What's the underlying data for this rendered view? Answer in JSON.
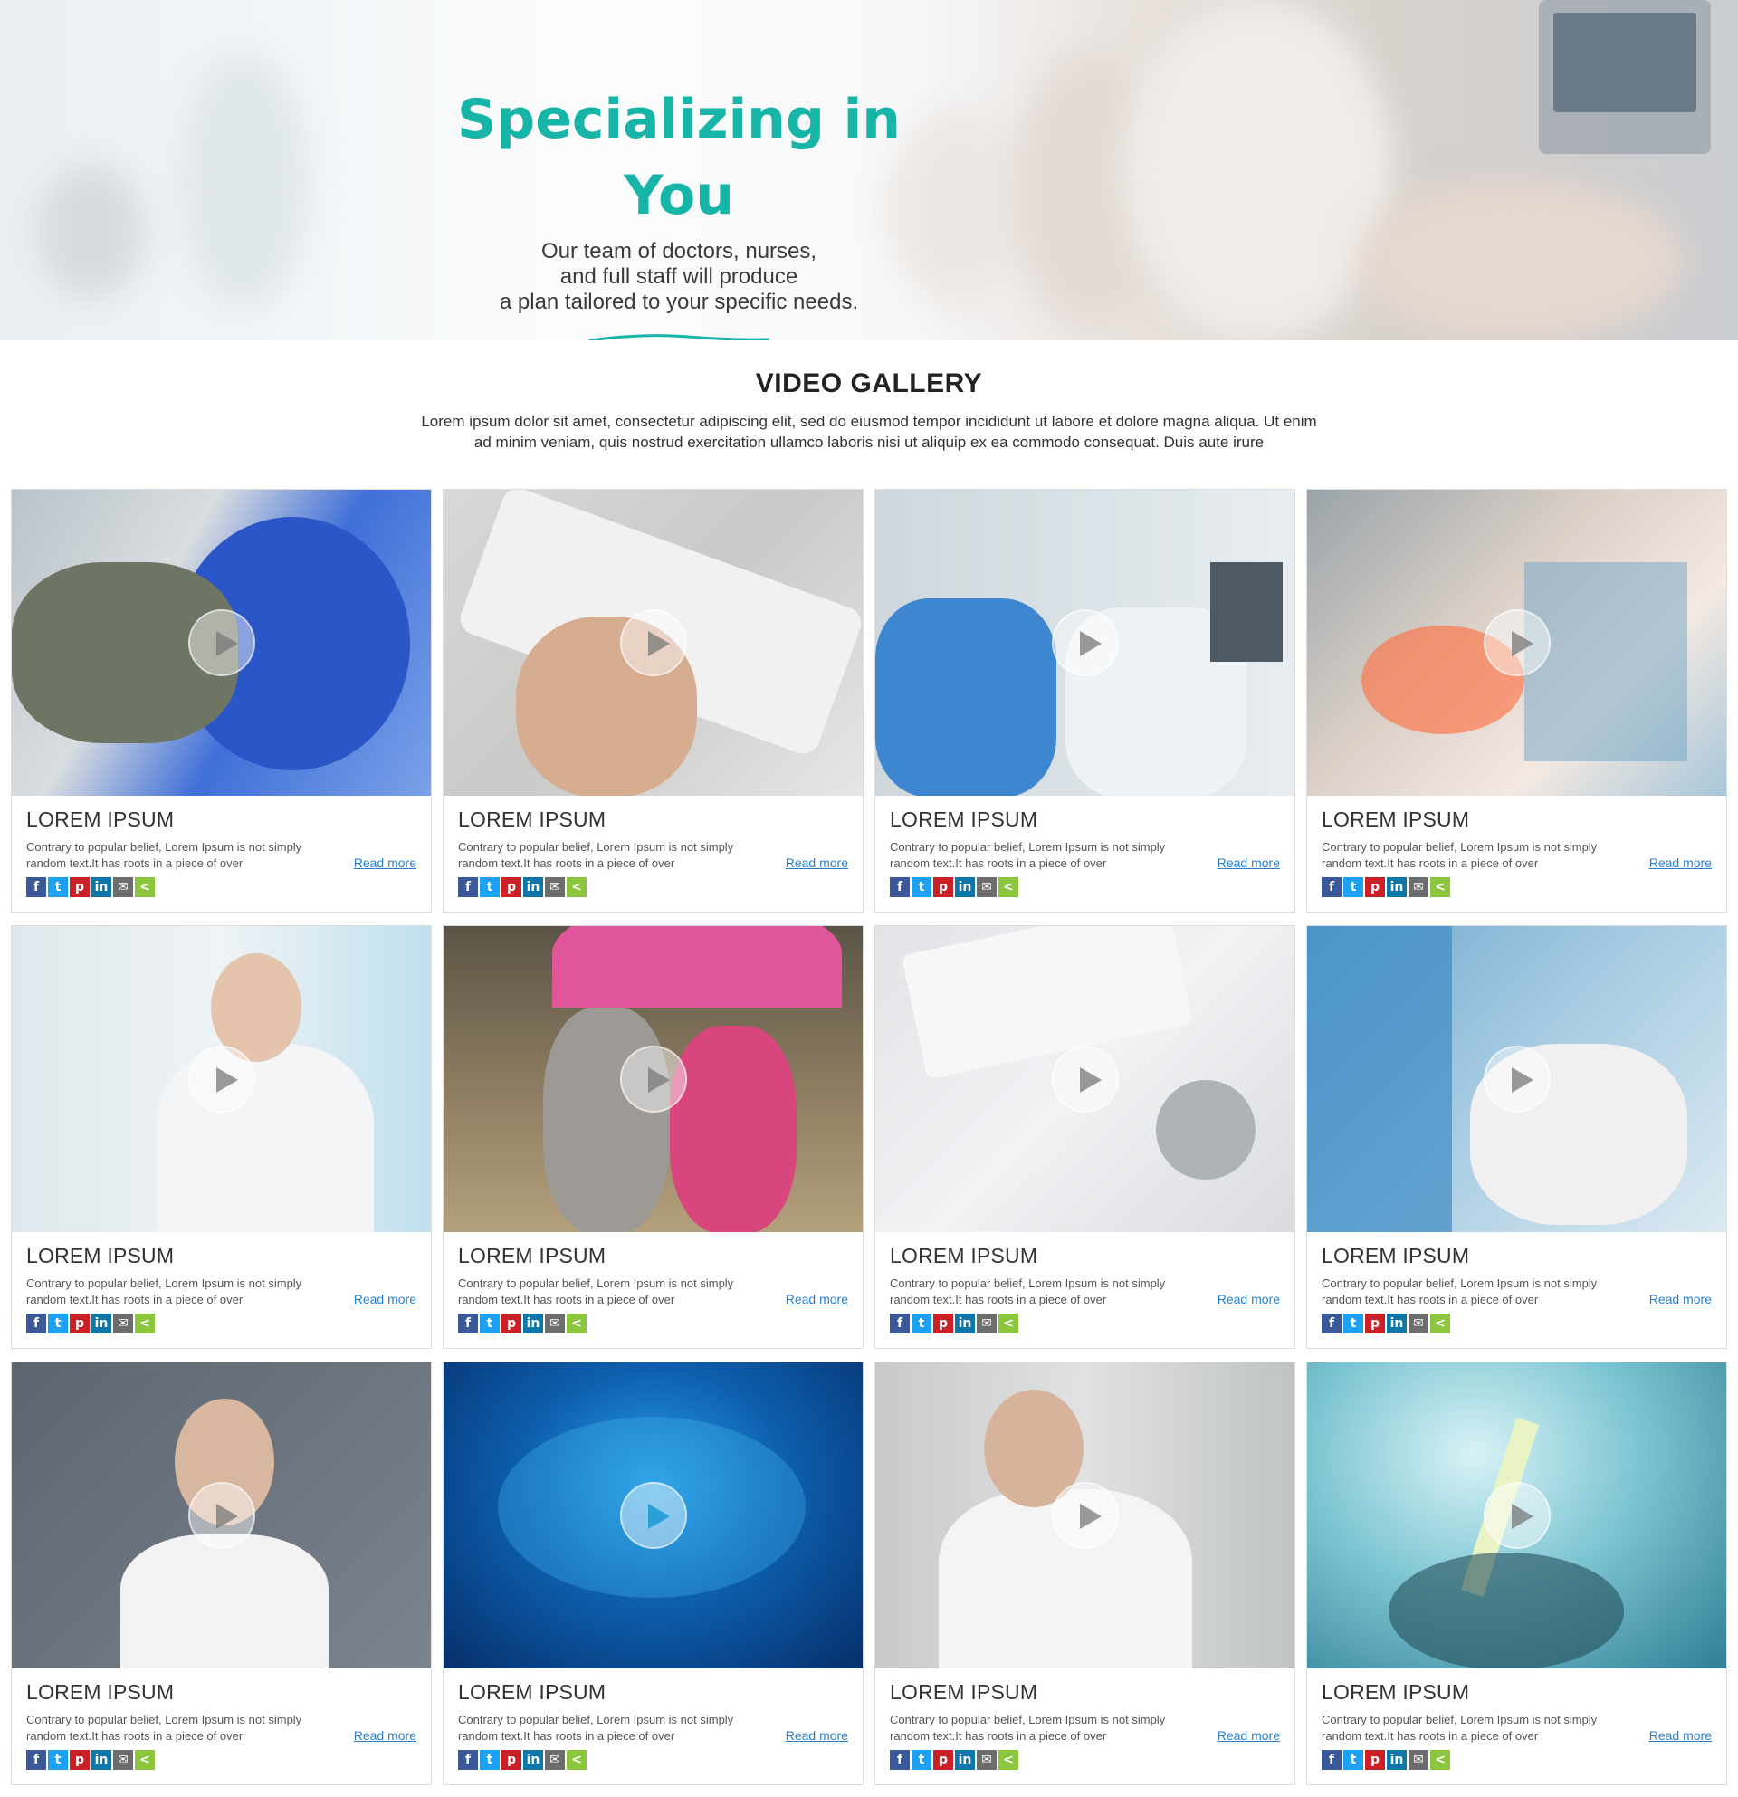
{
  "hero": {
    "title": "Specializing in You",
    "subtitle_lines": [
      "Our team of doctors, nurses,",
      "and full staff will produce",
      "a plan tailored to your specific needs."
    ],
    "accent_color": "#16b5a7"
  },
  "gallery": {
    "title": "VIDEO GALLERY",
    "description_lines": [
      "Lorem ipsum dolor sit amet, consectetur adipiscing elit, sed do eiusmod tempor incididunt ut labore et dolore magna aliqua. Ut enim",
      "ad minim veniam, quis nostrud exercitation ullamco laboris nisi ut aliquip ex ea commodo consequat. Duis aute irure"
    ]
  },
  "share_buttons": [
    {
      "icon": "facebook-icon",
      "glyph": "f",
      "color": "#3b5998"
    },
    {
      "icon": "twitter-icon",
      "glyph": "t",
      "color": "#1da1f2"
    },
    {
      "icon": "pinterest-icon",
      "glyph": "p",
      "color": "#cb2027"
    },
    {
      "icon": "linkedin-icon",
      "glyph": "in",
      "color": "#0e76a8"
    },
    {
      "icon": "email-icon",
      "glyph": "✉",
      "color": "#6d6d6d"
    },
    {
      "icon": "share-icon",
      "glyph": "<",
      "color": "#8cc63f"
    }
  ],
  "cards": [
    {
      "title": "LOREM IPSUM",
      "text_lines": [
        "Contrary to popular belief, Lorem Ipsum is not simply",
        "random text.It has roots in a piece of over"
      ],
      "read_more": "Read more",
      "image": "mri-scanner-patient",
      "play_style": "grey"
    },
    {
      "title": "LOREM IPSUM",
      "text_lines": [
        "Contrary to popular belief, Lorem Ipsum is not simply",
        "random text.It has roots in a piece of over"
      ],
      "read_more": "Read more",
      "image": "hand-holding-tablet",
      "play_style": "grey"
    },
    {
      "title": "LOREM IPSUM",
      "text_lines": [
        "Contrary to popular belief, Lorem Ipsum is not simply",
        "random text.It has roots in a piece of over"
      ],
      "read_more": "Read more",
      "image": "doctors-viewing-xray",
      "play_style": "grey"
    },
    {
      "title": "LOREM IPSUM",
      "text_lines": [
        "Contrary to popular belief, Lorem Ipsum is not simply",
        "random text.It has roots in a piece of over"
      ],
      "read_more": "Read more",
      "image": "lab-microscope",
      "play_style": "grey"
    },
    {
      "title": "LOREM IPSUM",
      "text_lines": [
        "Contrary to popular belief, Lorem Ipsum is not simply",
        "random text.It has roots in a piece of over"
      ],
      "read_more": "Read more",
      "image": "female-doctor-portrait",
      "play_style": "grey"
    },
    {
      "title": "LOREM IPSUM",
      "text_lines": [
        "Contrary to popular belief, Lorem Ipsum is not simply",
        "random text.It has roots in a piece of over"
      ],
      "read_more": "Read more",
      "image": "couple-pink-umbrella",
      "play_style": "grey"
    },
    {
      "title": "LOREM IPSUM",
      "text_lines": [
        "Contrary to popular belief, Lorem Ipsum is not simply",
        "random text.It has roots in a piece of over"
      ],
      "read_more": "Read more",
      "image": "billing-statement-stethoscope",
      "play_style": "grey"
    },
    {
      "title": "LOREM IPSUM",
      "text_lines": [
        "Contrary to popular belief, Lorem Ipsum is not simply",
        "random text.It has roots in a piece of over"
      ],
      "read_more": "Read more",
      "image": "nurse-with-girl",
      "play_style": "grey"
    },
    {
      "title": "LOREM IPSUM",
      "text_lines": [
        "Contrary to popular belief, Lorem Ipsum is not simply",
        "random text.It has roots in a piece of over"
      ],
      "read_more": "Read more",
      "image": "senior-doctor-portrait",
      "play_style": "grey"
    },
    {
      "title": "LOREM IPSUM",
      "text_lines": [
        "Contrary to popular belief, Lorem Ipsum is not simply",
        "random text.It has roots in a piece of over"
      ],
      "read_more": "Read more",
      "image": "blue-dna-abstract",
      "play_style": "blue"
    },
    {
      "title": "LOREM IPSUM",
      "text_lines": [
        "Contrary to popular belief, Lorem Ipsum is not simply",
        "random text.It has roots in a piece of over"
      ],
      "read_more": "Read more",
      "image": "scientist-with-vials",
      "play_style": "grey"
    },
    {
      "title": "LOREM IPSUM",
      "text_lines": [
        "Contrary to popular belief, Lorem Ipsum is not simply",
        "random text.It has roots in a piece of over"
      ],
      "read_more": "Read more",
      "image": "syringe-teal",
      "play_style": "grey"
    }
  ]
}
